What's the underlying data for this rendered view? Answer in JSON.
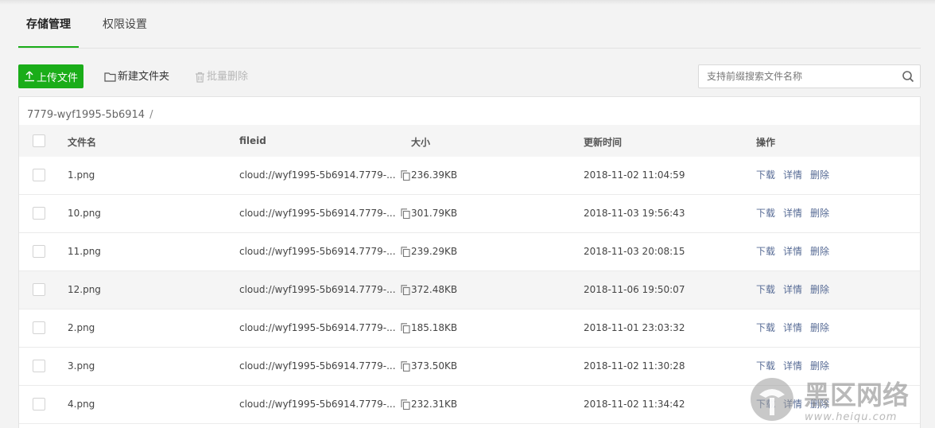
{
  "tabs": [
    {
      "label": "存储管理",
      "active": true
    },
    {
      "label": "权限设置",
      "active": false
    }
  ],
  "toolbar": {
    "upload_label": "上传文件",
    "new_folder_label": "新建文件夹",
    "batch_delete_label": "批量删除"
  },
  "search": {
    "placeholder": "支持前缀搜索文件名称",
    "value": ""
  },
  "breadcrumb": {
    "path": "7779-wyf1995-5b6914",
    "separator": "/"
  },
  "table": {
    "headers": {
      "name": "文件名",
      "fileid": "fileid",
      "size": "大小",
      "time": "更新时间",
      "ops": "操作"
    },
    "rows": [
      {
        "name": "1.png",
        "fileid": "cloud://wyf1995-5b6914.7779-...",
        "size": "236.39KB",
        "time": "2018-11-02 11:04:59"
      },
      {
        "name": "10.png",
        "fileid": "cloud://wyf1995-5b6914.7779-...",
        "size": "301.79KB",
        "time": "2018-11-03 19:56:43"
      },
      {
        "name": "11.png",
        "fileid": "cloud://wyf1995-5b6914.7779-...",
        "size": "239.29KB",
        "time": "2018-11-03 20:08:15"
      },
      {
        "name": "12.png",
        "fileid": "cloud://wyf1995-5b6914.7779-...",
        "size": "372.48KB",
        "time": "2018-11-06 19:50:07"
      },
      {
        "name": "2.png",
        "fileid": "cloud://wyf1995-5b6914.7779-...",
        "size": "185.18KB",
        "time": "2018-11-01 23:03:32"
      },
      {
        "name": "3.png",
        "fileid": "cloud://wyf1995-5b6914.7779-...",
        "size": "373.50KB",
        "time": "2018-11-02 11:30:28"
      },
      {
        "name": "4.png",
        "fileid": "cloud://wyf1995-5b6914.7779-...",
        "size": "232.31KB",
        "time": "2018-11-02 11:34:42"
      }
    ],
    "actions": {
      "download": "下载",
      "detail": "详情",
      "delete": "删除"
    }
  },
  "watermark": {
    "brand": "黑区网络",
    "url": "www.heiqu.com"
  },
  "colors": {
    "accent": "#1aad19",
    "link": "#576b95",
    "disabled": "#b7b7b7",
    "page_bg": "#f3f3f3"
  },
  "icons": [
    "upload-icon",
    "folder-icon",
    "trash-icon",
    "search-icon",
    "copy-icon",
    "watermark-logo"
  ]
}
